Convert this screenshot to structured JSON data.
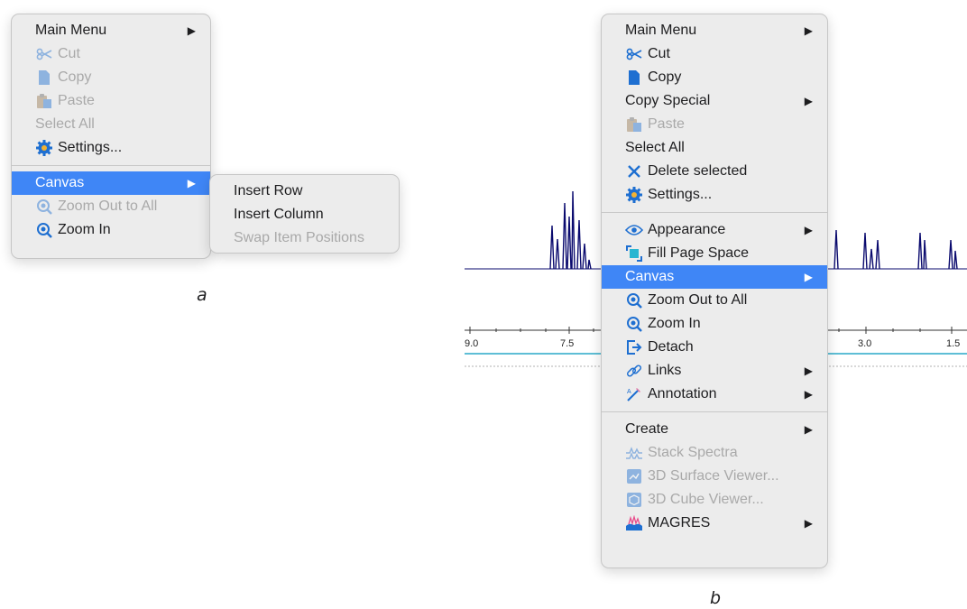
{
  "menu_a": {
    "items": {
      "main_menu": "Main Menu",
      "cut": "Cut",
      "copy": "Copy",
      "paste": "Paste",
      "select_all": "Select All",
      "settings": "Settings...",
      "canvas": "Canvas",
      "zoom_out_all": "Zoom Out to All",
      "zoom_in": "Zoom In"
    },
    "caption": "a"
  },
  "submenu_canvas": {
    "items": [
      "Insert Row",
      "Insert Column",
      "Swap Item Positions"
    ]
  },
  "menu_b": {
    "items": {
      "main_menu": "Main Menu",
      "cut": "Cut",
      "copy": "Copy",
      "copy_special": "Copy Special",
      "paste": "Paste",
      "select_all": "Select All",
      "delete_selected": "Delete selected",
      "settings": "Settings...",
      "appearance": "Appearance",
      "fill_page_space": "Fill Page Space",
      "canvas": "Canvas",
      "zoom_out_all": "Zoom Out to All",
      "zoom_in": "Zoom In",
      "detach": "Detach",
      "links": "Links",
      "annotation": "Annotation",
      "create": "Create",
      "stack_spectra": "Stack Spectra",
      "surface_viewer": "3D Surface Viewer...",
      "cube_viewer": "3D Cube Viewer...",
      "magres": "MAGRES"
    },
    "caption": "b"
  },
  "spectrum_axis": {
    "ticks": [
      "9.0",
      "7.5",
      "3.0",
      "1.5"
    ]
  },
  "colors": {
    "highlight": "#3f86f6",
    "menu_bg": "#ececec",
    "spectrum": "#0a0a6e",
    "axis_line": "#29a9c8"
  }
}
